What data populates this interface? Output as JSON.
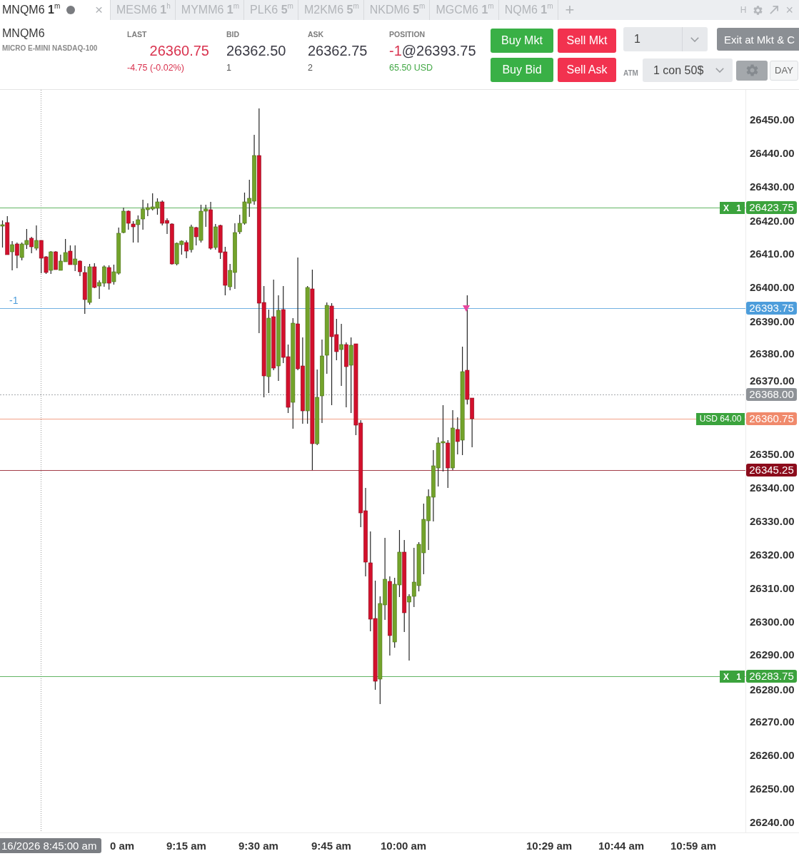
{
  "tab_bar": {
    "tabs": [
      {
        "label": "MNQM6 **1**$^{m}$",
        "selected": true
      },
      {
        "label": "MESM6 **1**$^{h}$",
        "selected": false
      },
      {
        "label": "MYMM6 **1**$^{m}$",
        "selected": false
      },
      {
        "label": "PLK6 **5**$^{m}$",
        "selected": false
      },
      {
        "label": "M2KM6 **5**$^{m}$",
        "selected": false
      },
      {
        "label": "NKDM6 **5**$^{m}$",
        "selected": false
      },
      {
        "label": "MGCM6 **1**$^{m}$",
        "selected": false
      },
      {
        "label": "NQM6 **1**$^{m}$",
        "selected": false
      }
    ],
    "close_tab": "×",
    "add_tab": "+",
    "hotkey": "H",
    "close_window": "×"
  },
  "instrument": {
    "symbol": "MNQM6",
    "description": "MICRO E-MINI NASDAQ-100"
  },
  "quotes": [
    {
      "label": "LAST",
      "value": "26360.75",
      "detail": "-4.75 (-0.02%)",
      "down": true
    },
    {
      "label": "BID",
      "value": "26362.50",
      "detail": "1",
      "down": false
    },
    {
      "label": "ASK",
      "value": "26362.75",
      "detail": "2",
      "down": false
    }
  ],
  "position": {
    "label": "POSITION",
    "quantity": "-1",
    "short": true,
    "price": "@26393.75",
    "pnl": "65.50 USD",
    "profit": true
  },
  "order_buttons": [
    {
      "label": "Buy Mkt",
      "kind": "buy"
    },
    {
      "label": "Sell Mkt",
      "kind": "sell"
    },
    {
      "label": "Buy Bid",
      "kind": "buy"
    },
    {
      "label": "Sell Ask",
      "kind": "sell"
    }
  ],
  "quantity": {
    "value": "1"
  },
  "exit_button": "Exit at Mkt & C",
  "atm": {
    "label": "ATM",
    "value": "1 con 50$"
  },
  "time_in_force": "DAY",
  "chart": {
    "price_axis": [
      "26450.00",
      "26440.00",
      "26430.00",
      "26420.00",
      "26410.00",
      "26400.00",
      "26390.00",
      "26380.00",
      "26370.00",
      "26350.00",
      "26340.00",
      "26330.00",
      "26320.00",
      "26310.00",
      "26300.00",
      "26290.00",
      "26280.00",
      "26270.00",
      "26260.00",
      "26250.00",
      "26240.00"
    ],
    "price_lines": [
      {
        "price": "26423.75",
        "color": "#3ba33d",
        "kind": "solid",
        "order": {
          "cancel": "X",
          "quantity": "1"
        }
      },
      {
        "price": "26393.75",
        "color": "#4d9ddb",
        "kind": "solid",
        "side_label": "-1"
      },
      {
        "price": "26368.00",
        "color": "#8e9297",
        "kind": "dotted"
      },
      {
        "price": "26360.75",
        "color": "#f08a6c",
        "kind": "solid",
        "pnl": "USD 64.00"
      },
      {
        "price": "26345.25",
        "color": "#8c0c1c",
        "kind": "solid"
      },
      {
        "price": "26283.75",
        "color": "#3ba33d",
        "kind": "solid",
        "order": {
          "cancel": "X",
          "quantity": "1"
        }
      }
    ],
    "crosshair_time": "16/2026 8:45:00 am",
    "time_axis": [
      "0 am",
      "9:15 am",
      "9:30 am",
      "9:45 am",
      "10:00 am",
      "10:29 am",
      "10:44 am",
      "10:59 am"
    ]
  }
}
